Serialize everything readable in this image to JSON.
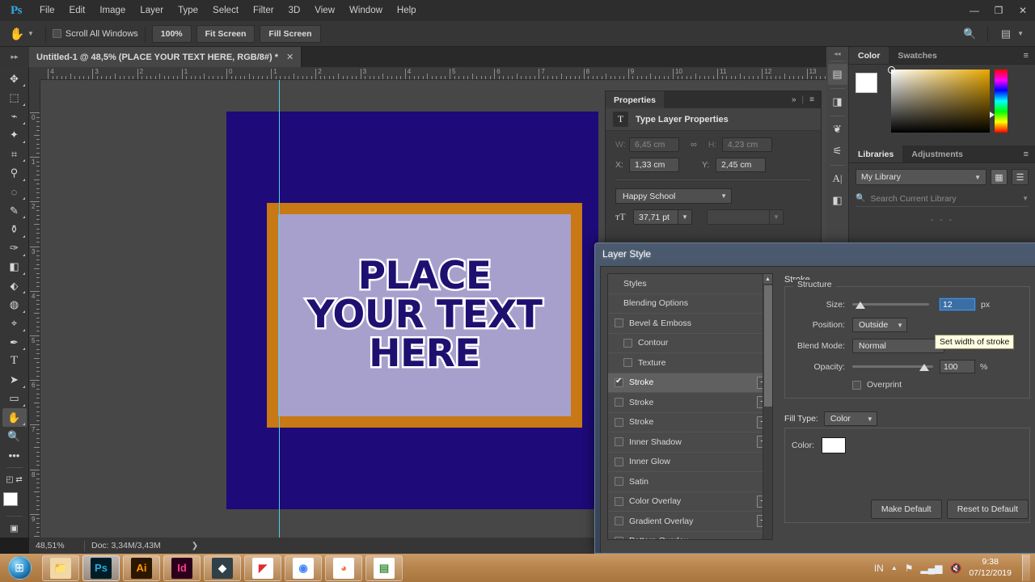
{
  "app": {
    "name": "Photoshop",
    "logo": "Ps"
  },
  "menu": {
    "items": [
      "File",
      "Edit",
      "Image",
      "Layer",
      "Type",
      "Select",
      "Filter",
      "3D",
      "View",
      "Window",
      "Help"
    ]
  },
  "window_controls": {
    "minimize": "—",
    "restore": "❐",
    "close": "✕"
  },
  "options_bar": {
    "tool_icon": "hand-tool",
    "scroll_all_windows": "Scroll All Windows",
    "scroll_all_windows_checked": false,
    "buttons": [
      "100%",
      "Fit Screen",
      "Fill Screen"
    ],
    "right_icons": [
      "search-icon",
      "workspace-icon"
    ]
  },
  "document_tab": {
    "title": "Untitled-1 @ 48,5% (PLACE YOUR TEXT HERE, RGB/8#) *",
    "close": "✕"
  },
  "toolbar": {
    "tools": [
      {
        "name": "move-tool",
        "glyph": "✥"
      },
      {
        "name": "rectangular-marquee-tool",
        "glyph": "▭"
      },
      {
        "name": "lasso-tool",
        "glyph": "⌁"
      },
      {
        "name": "magic-wand-tool",
        "glyph": "✨"
      },
      {
        "name": "crop-tool",
        "glyph": "⌗"
      },
      {
        "name": "eyedropper-tool",
        "glyph": "⚲"
      },
      {
        "name": "spot-healing-brush-tool",
        "glyph": "◌"
      },
      {
        "name": "brush-tool",
        "glyph": "🖌"
      },
      {
        "name": "clone-stamp-tool",
        "glyph": "⚱"
      },
      {
        "name": "history-brush-tool",
        "glyph": "🖍"
      },
      {
        "name": "eraser-tool",
        "glyph": "◨"
      },
      {
        "name": "paint-bucket-tool",
        "glyph": "⬖"
      },
      {
        "name": "gradient-tool",
        "glyph": "◍"
      },
      {
        "name": "dodge-tool",
        "glyph": "⌖"
      },
      {
        "name": "pen-tool",
        "glyph": "✒"
      },
      {
        "name": "type-tool",
        "glyph": "T"
      },
      {
        "name": "path-selection-tool",
        "glyph": "➤"
      },
      {
        "name": "rectangle-tool",
        "glyph": "▬"
      },
      {
        "name": "hand-tool",
        "glyph": "✋",
        "active": true
      },
      {
        "name": "zoom-tool",
        "glyph": "🔍"
      },
      {
        "name": "edit-toolbar-tool",
        "glyph": "•••"
      }
    ],
    "swap_colors": "⇄",
    "foreground_color": "#ffffff",
    "background_color": "#b01030",
    "quick_mask": "quick-mask-icon"
  },
  "rulers": {
    "unit": "cm",
    "horizontal_labels": [
      "4",
      "3",
      "2",
      "1",
      "0",
      "1",
      "2",
      "3",
      "4",
      "5",
      "6",
      "7",
      "8",
      "9",
      "10",
      "11",
      "12",
      "13"
    ],
    "vertical_labels": [
      "0",
      "1",
      "2",
      "3",
      "4",
      "5",
      "6",
      "7",
      "8",
      "9"
    ]
  },
  "canvas": {
    "artwork": {
      "background_color": "#1e0a78",
      "frame_color": "#c87814",
      "inner_color": "#a8a0cc",
      "text_color": "#1e1070",
      "stroke_color": "#ffffff",
      "lines": [
        "PLACE",
        "YOUR TEXT",
        "HERE"
      ]
    },
    "guide_color": "#4fd0e8"
  },
  "status_bar": {
    "zoom": "48,51%",
    "doc": "Doc: 3,34M/3,43M",
    "arrow": "❯"
  },
  "right_rail": {
    "collapse": "◂◂",
    "icons": [
      {
        "name": "adjustments-icon",
        "glyph": "▤"
      },
      {
        "name": "layer-comps-icon",
        "glyph": "◨"
      },
      {
        "name": "brushes-icon",
        "glyph": "❦"
      },
      {
        "name": "brush-settings-icon",
        "glyph": "⚟"
      },
      {
        "name": "character-icon",
        "glyph": "A"
      },
      {
        "name": "paragraph-icon",
        "glyph": "▰"
      }
    ]
  },
  "color_panel": {
    "tabs": [
      {
        "label": "Color",
        "active": true
      },
      {
        "label": "Swatches",
        "active": false
      }
    ],
    "menu_icon": "panel-menu-icon",
    "foreground_color": "#ffffff",
    "background_color": "#b01030"
  },
  "libraries_panel": {
    "tabs": [
      {
        "label": "Libraries",
        "active": true
      },
      {
        "label": "Adjustments",
        "active": false
      }
    ],
    "menu_icon": "panel-menu-icon",
    "library_name": "My Library",
    "search_placeholder": "Search Current Library",
    "view_grid": "grid-view-icon",
    "view_list": "list-view-icon"
  },
  "properties_panel": {
    "tab_label": "Properties",
    "expand_icon": "»",
    "menu_icon": "≡",
    "header_title": "Type Layer Properties",
    "header_icon": "T",
    "fields": {
      "w_label": "W:",
      "w_value": "6,45 cm",
      "link_icon": "∞",
      "h_label": "H:",
      "h_value": "4,23 cm",
      "x_label": "X:",
      "x_value": "1,33 cm",
      "y_label": "Y:",
      "y_value": "2,45 cm",
      "font_family": "Happy School",
      "font_size_icon": "ᴛT",
      "font_size": "37,71 pt"
    }
  },
  "layer_style_dialog": {
    "title": "Layer Style",
    "styles_list": [
      {
        "label": "Styles",
        "type": "header"
      },
      {
        "label": "Blending Options",
        "type": "header"
      },
      {
        "label": "Bevel & Emboss",
        "checked": false,
        "indent": 0,
        "plus": false
      },
      {
        "label": "Contour",
        "checked": false,
        "indent": 1,
        "plus": false
      },
      {
        "label": "Texture",
        "checked": false,
        "indent": 1,
        "plus": false
      },
      {
        "label": "Stroke",
        "checked": true,
        "indent": 0,
        "plus": true,
        "selected": true
      },
      {
        "label": "Stroke",
        "checked": false,
        "indent": 0,
        "plus": true
      },
      {
        "label": "Stroke",
        "checked": false,
        "indent": 0,
        "plus": true
      },
      {
        "label": "Inner Shadow",
        "checked": false,
        "indent": 0,
        "plus": true
      },
      {
        "label": "Inner Glow",
        "checked": false,
        "indent": 0,
        "plus": false
      },
      {
        "label": "Satin",
        "checked": false,
        "indent": 0,
        "plus": false
      },
      {
        "label": "Color Overlay",
        "checked": false,
        "indent": 0,
        "plus": true
      },
      {
        "label": "Gradient Overlay",
        "checked": false,
        "indent": 0,
        "plus": true
      },
      {
        "label": "Pattern Overlay",
        "checked": false,
        "indent": 0,
        "plus": false
      }
    ],
    "stroke": {
      "section_title": "Stroke",
      "structure_title": "Structure",
      "size_label": "Size:",
      "size_value": "12",
      "size_unit": "px",
      "size_tooltip": "Set width of stroke",
      "position_label": "Position:",
      "position_value": "Outside",
      "blend_mode_label": "Blend Mode:",
      "blend_mode_value": "Normal",
      "opacity_label": "Opacity:",
      "opacity_value": "100",
      "opacity_unit": "%",
      "overprint_label": "Overprint",
      "overprint_checked": false,
      "fill_type_label": "Fill Type:",
      "fill_type_value": "Color",
      "color_label": "Color:",
      "color_value": "#ffffff"
    },
    "buttons": {
      "make_default": "Make Default",
      "reset_to_default": "Reset to Default"
    }
  },
  "taskbar": {
    "start": "start-orb",
    "apps": [
      {
        "name": "file-explorer",
        "label": "📁",
        "bg": "#f0d8a8",
        "fg": "#7a5a20"
      },
      {
        "name": "photoshop",
        "label": "Ps",
        "bg": "#001d26",
        "fg": "#31a8e0",
        "running": true
      },
      {
        "name": "illustrator",
        "label": "Ai",
        "bg": "#2b1600",
        "fg": "#ff9a00"
      },
      {
        "name": "indesign",
        "label": "Id",
        "bg": "#2b001c",
        "fg": "#ff3d8b"
      },
      {
        "name": "lumion",
        "label": "◆",
        "bg": "#2f4048",
        "fg": "#ffffff"
      },
      {
        "name": "sketchup",
        "label": "◤",
        "bg": "#ffffff",
        "fg": "#e02b2b"
      },
      {
        "name": "chrome",
        "label": "◉",
        "bg": "#ffffff",
        "fg": "#4285f4"
      },
      {
        "name": "firefox",
        "label": "◕",
        "bg": "#ffffff",
        "fg": "#ff7139"
      },
      {
        "name": "notes",
        "label": "▤",
        "bg": "#ffffff",
        "fg": "#3f8f3f"
      }
    ],
    "tray": {
      "language": "IN",
      "show_hidden": "▲",
      "network_flag": "⚑",
      "signal": "signal-bars-icon",
      "volume": "volume-muted-icon",
      "time": "9:38",
      "date": "07/12/2019"
    }
  }
}
